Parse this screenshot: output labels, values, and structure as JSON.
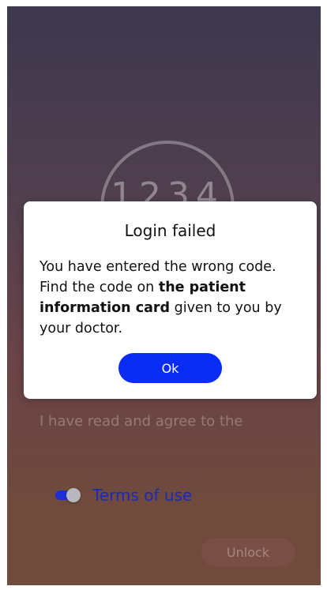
{
  "background": {
    "code_placeholder": "1234",
    "agree_text": "I have read and agree to the",
    "terms_toggle_on": true,
    "terms_link_label": "Terms of use",
    "unlock_label": "Unlock"
  },
  "dialog": {
    "title": "Login failed",
    "message_part1": "You have entered the wrong code. Find the code on ",
    "message_bold": "the patient information card",
    "message_part2": " given to you by your doctor.",
    "ok_label": "Ok"
  },
  "colors": {
    "accent": "#0a2cf5",
    "toggle": "#1c2fd6",
    "link": "#1a2bb8"
  }
}
